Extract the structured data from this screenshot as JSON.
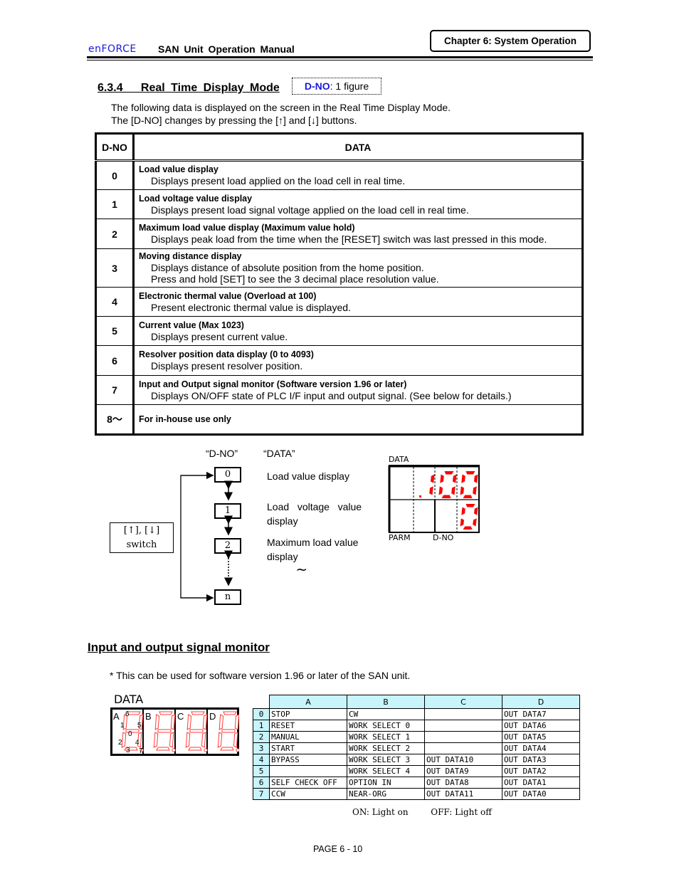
{
  "header": {
    "logo": "enFORCE",
    "manual_title": "SAN Unit Operation Manual",
    "chapter": "Chapter 6: System Operation"
  },
  "section": {
    "title": "6.3.4   Real Time Display Mode",
    "dno_label": "D-NO",
    "dno_suffix": ": 1 figure",
    "intro_lines": [
      "The following data is displayed on the screen in the Real Time Display Mode.",
      "The [D-NO] changes by pressing the [↑] and [↓] buttons."
    ]
  },
  "table": {
    "headers": [
      "D-NO",
      "DATA"
    ],
    "rows": [
      {
        "dno": "0",
        "title": "Load value display",
        "lines": [
          "Displays present load applied on the load cell in real time."
        ]
      },
      {
        "dno": "1",
        "title": "Load voltage value display",
        "lines": [
          "Displays present load signal voltage applied on the load cell in real time."
        ]
      },
      {
        "dno": "2",
        "title": "Maximum load value display (Maximum value hold)",
        "lines": [
          "Displays peak load from the time when the [RESET] switch was last pressed in this mode."
        ]
      },
      {
        "dno": "3",
        "title": "Moving distance display",
        "lines": [
          "Displays distance of absolute position from the home position.",
          "Press and hold [SET] to see the 3 decimal place resolution value."
        ]
      },
      {
        "dno": "4",
        "title": "Electronic thermal value (Overload at 100)",
        "lines": [
          "Present electronic thermal value is displayed."
        ]
      },
      {
        "dno": "5",
        "title": "Current value (Max 1023)",
        "lines": [
          "Displays present current value."
        ]
      },
      {
        "dno": "6",
        "title": "Resolver position data display (0 to 4093)",
        "lines": [
          "Displays present resolver position."
        ]
      },
      {
        "dno": "7",
        "title": "Input and Output signal monitor (Software version 1.96 or later)",
        "lines": [
          "Displays ON/OFF state of PLC I/F input and output signal. (See below for details.)"
        ]
      },
      {
        "dno": "8〜",
        "title": "For in-house use only",
        "lines": []
      }
    ]
  },
  "flow": {
    "dno_heading": "“D-NO”",
    "data_heading": "“DATA”",
    "boxes": [
      "0",
      "1",
      "2",
      "n"
    ],
    "labels": [
      "Load value display",
      "Load   voltage   value display",
      "Maximum load value display"
    ],
    "switch_line1": "[↑], [↓]",
    "switch_line2": "switch",
    "continuation": "≀"
  },
  "led_display": {
    "top_label": "DATA",
    "data_value": "100",
    "dno_value": "0",
    "bottom_left": "PARM",
    "bottom_right": "D-NO",
    "color": "#ff0000"
  },
  "io_monitor": {
    "title": "Input and output signal monitor",
    "note": "* This can be used for software version 1.96 or later of the SAN unit.",
    "led_label": "DATA",
    "digit_letters": [
      "A",
      "B",
      "C",
      "D"
    ],
    "segment_numbers": [
      "6",
      "1",
      "5",
      "0",
      "2",
      "4",
      "3",
      "7"
    ],
    "columns": [
      "A",
      "B",
      "C",
      "D"
    ],
    "rows": [
      {
        "bit": "0",
        "cells": [
          "STOP",
          "CW",
          "",
          "OUT DATA7"
        ]
      },
      {
        "bit": "1",
        "cells": [
          "RESET",
          "WORK SELECT 0",
          "",
          "OUT DATA6"
        ]
      },
      {
        "bit": "2",
        "cells": [
          "MANUAL",
          "WORK SELECT 1",
          "",
          "OUT DATA5"
        ]
      },
      {
        "bit": "3",
        "cells": [
          "START",
          "WORK SELECT 2",
          "",
          "OUT DATA4"
        ]
      },
      {
        "bit": "4",
        "cells": [
          "BYPASS",
          "WORK SELECT 3",
          "OUT DATA10",
          "OUT DATA3"
        ]
      },
      {
        "bit": "5",
        "cells": [
          "",
          "WORK SELECT 4",
          "OUT DATA9",
          "OUT DATA2"
        ]
      },
      {
        "bit": "6",
        "cells": [
          "SELF CHECK OFF",
          "OPTION IN",
          "OUT DATA8",
          "OUT DATA1"
        ]
      },
      {
        "bit": "7",
        "cells": [
          "CCW",
          "NEAR-ORG",
          "OUT DATA11",
          "OUT DATA0"
        ]
      }
    ],
    "legend_on": "ON: Light on",
    "legend_off": "OFF: Light off",
    "header_color": "#c8f4fb"
  },
  "footer": {
    "page": "PAGE 6 - 10"
  }
}
